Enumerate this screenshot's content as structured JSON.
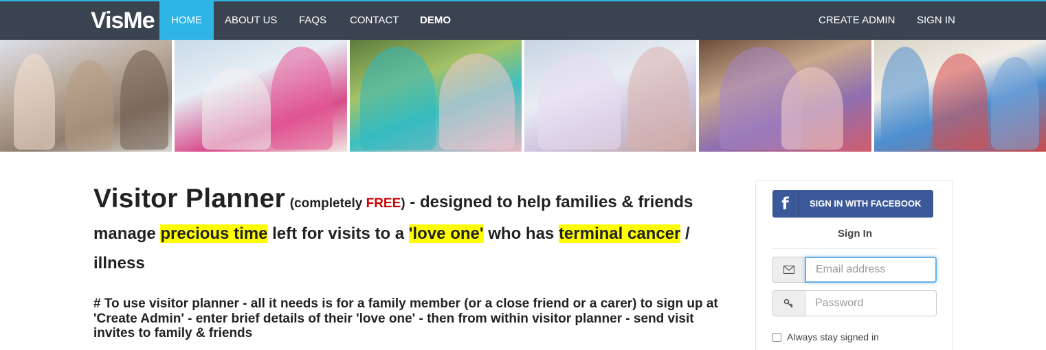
{
  "brand": "VisMe",
  "nav": {
    "home": "HOME",
    "about": "ABOUT US",
    "faqs": "FAQS",
    "contact": "CONTACT",
    "demo": "DEMO",
    "create_admin": "CREATE ADMIN",
    "sign_in": "SIGN IN"
  },
  "banner": {
    "photos": [
      "caregiver-photo-1",
      "caregiver-photo-2",
      "caregiver-photo-3",
      "caregiver-photo-4",
      "caregiver-photo-5",
      "caregiver-photo-6"
    ]
  },
  "headline": {
    "title": "Visitor Planner",
    "paren_open": "(completely ",
    "free": "FREE",
    "paren_close": ")",
    "part1": " - designed to help families & friends manage ",
    "hl1": "precious time",
    "part2": " left for visits to a ",
    "hl2": "'love one'",
    "part3": " who has ",
    "hl3": "terminal cancer",
    "part4": " / illness"
  },
  "subtext": "# To use visitor planner - all it needs is for a family member (or a close friend or a carer) to sign up at 'Create Admin' - enter brief details of their 'love one' - then from within visitor planner - send visit invites to family & friends",
  "signin": {
    "facebook_label": "SIGN IN WITH FACEBOOK",
    "facebook_icon": "f",
    "title": "Sign In",
    "email_placeholder": "Email address",
    "password_placeholder": "Password",
    "remember_label": "Always stay signed in"
  },
  "colors": {
    "navbar": "#3a4350",
    "accent": "#2fb4e6",
    "facebook": "#3b5998",
    "highlight": "#ffff00",
    "free": "#cc0000"
  }
}
